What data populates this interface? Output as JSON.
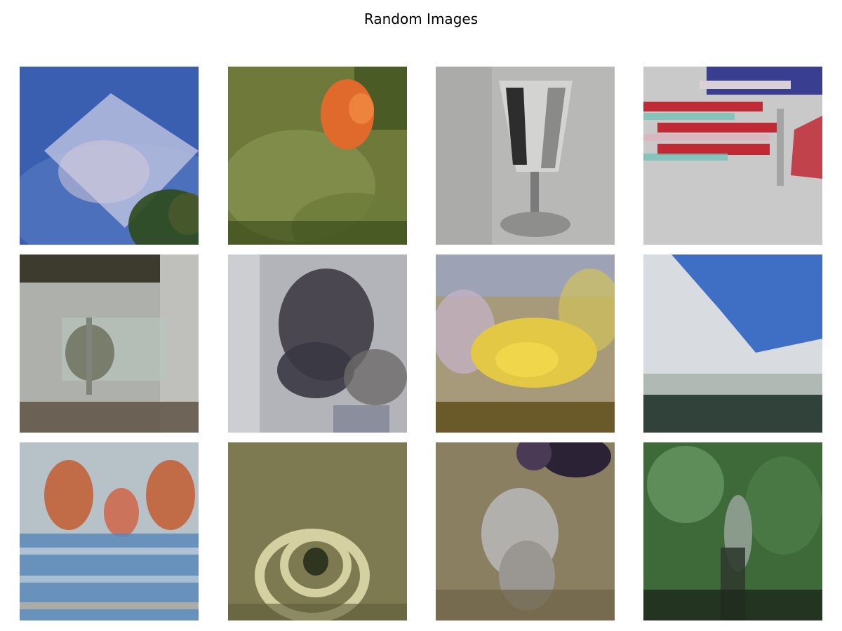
{
  "figure": {
    "title": "Random Images",
    "rows": 3,
    "cols": 4
  },
  "images": [
    {
      "subject": "sky-and-clouds",
      "palette": {
        "bg": "#3a5fb0",
        "main": "#b8bedf",
        "accent": "#2e4a1a"
      }
    },
    {
      "subject": "orange-flower-in-grass",
      "palette": {
        "bg": "#6f7a3a",
        "main": "#e06a2c",
        "accent": "#2f3f14"
      }
    },
    {
      "subject": "wine-glass",
      "palette": {
        "bg": "#b8b8b6",
        "main": "#6b6b6b",
        "accent": "#2d2d2d"
      }
    },
    {
      "subject": "flag-stripes",
      "palette": {
        "bg": "#c9c9c9",
        "main": "#c02a34",
        "accent": "#2a2f8a"
      }
    },
    {
      "subject": "plant-by-window",
      "palette": {
        "bg": "#aeb1ab",
        "main": "#6d725f",
        "accent": "#5a4d3e"
      }
    },
    {
      "subject": "dark-animal-blob",
      "palette": {
        "bg": "#b3b4b9",
        "main": "#4b4751",
        "accent": "#7b7f91"
      }
    },
    {
      "subject": "yellow-flowers",
      "palette": {
        "bg": "#a79a7a",
        "main": "#e2c844",
        "accent": "#5b4a16"
      }
    },
    {
      "subject": "sky-over-land",
      "palette": {
        "bg": "#d8dce0",
        "main": "#3f6fc4",
        "accent": "#30423a"
      }
    },
    {
      "subject": "two-faces-and-plaid",
      "palette": {
        "bg": "#b7c2c8",
        "main": "#c26b47",
        "accent": "#5b88b8"
      }
    },
    {
      "subject": "coiled-snake",
      "palette": {
        "bg": "#7d7a52",
        "main": "#d4d0a2",
        "accent": "#303520"
      }
    },
    {
      "subject": "tabby-cat",
      "palette": {
        "bg": "#8a7f61",
        "main": "#b2b0ad",
        "accent": "#2b2235"
      }
    },
    {
      "subject": "foliage-and-animal",
      "palette": {
        "bg": "#3e6a3a",
        "main": "#8a9b8c",
        "accent": "#1f2c1c"
      }
    }
  ]
}
